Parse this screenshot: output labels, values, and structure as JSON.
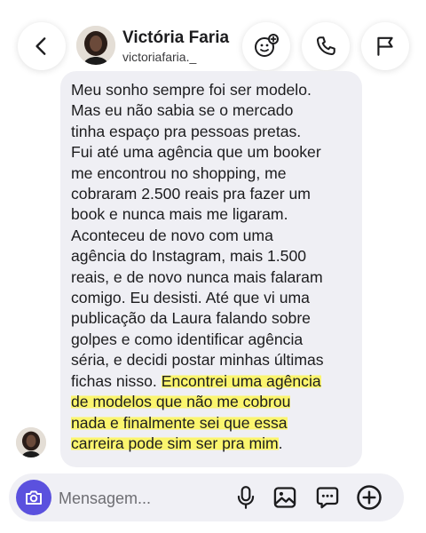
{
  "header": {
    "name": "Victória Faria",
    "username": "victoriafaria._"
  },
  "message": {
    "lines_plain": [
      "Meu sonho sempre foi ser modelo.",
      "Mas eu não sabia se o mercado",
      "tinha espaço pra pessoas pretas.",
      "Fui até uma agência que um booker",
      "me encontrou no shopping, me",
      "cobraram 2.500 reais pra fazer um",
      "book e nunca mais me ligaram.",
      "Aconteceu de novo com uma",
      "agência do Instagram, mais 1.500",
      "reais, e de novo nunca mais falaram",
      "comigo. Eu desisti. Até que vi uma",
      "publicação da Laura falando sobre",
      "golpes e como identificar agência",
      "séria, e decidi postar minhas últimas"
    ],
    "line_mixed_plain": "fichas nisso. ",
    "line_mixed_highlight": "Encontrei uma agência",
    "lines_highlight": [
      "de modelos que não me cobrou",
      "nada e finalmente sei que essa",
      "carreira pode sim ser pra mim"
    ],
    "final_period": "."
  },
  "composer": {
    "placeholder": "Mensagem..."
  },
  "icons": {
    "back": "chevron-left-icon",
    "sticker": "sticker-smiley-icon",
    "call": "phone-icon",
    "flag": "flag-icon",
    "camera": "camera-icon",
    "mic": "microphone-icon",
    "gallery": "image-icon",
    "sticker_chat": "sticker-chat-icon",
    "plus": "plus-circle-icon"
  },
  "colors": {
    "accent": "#5b51de",
    "bubble": "#efeff4",
    "highlight": "#fbf56e"
  }
}
